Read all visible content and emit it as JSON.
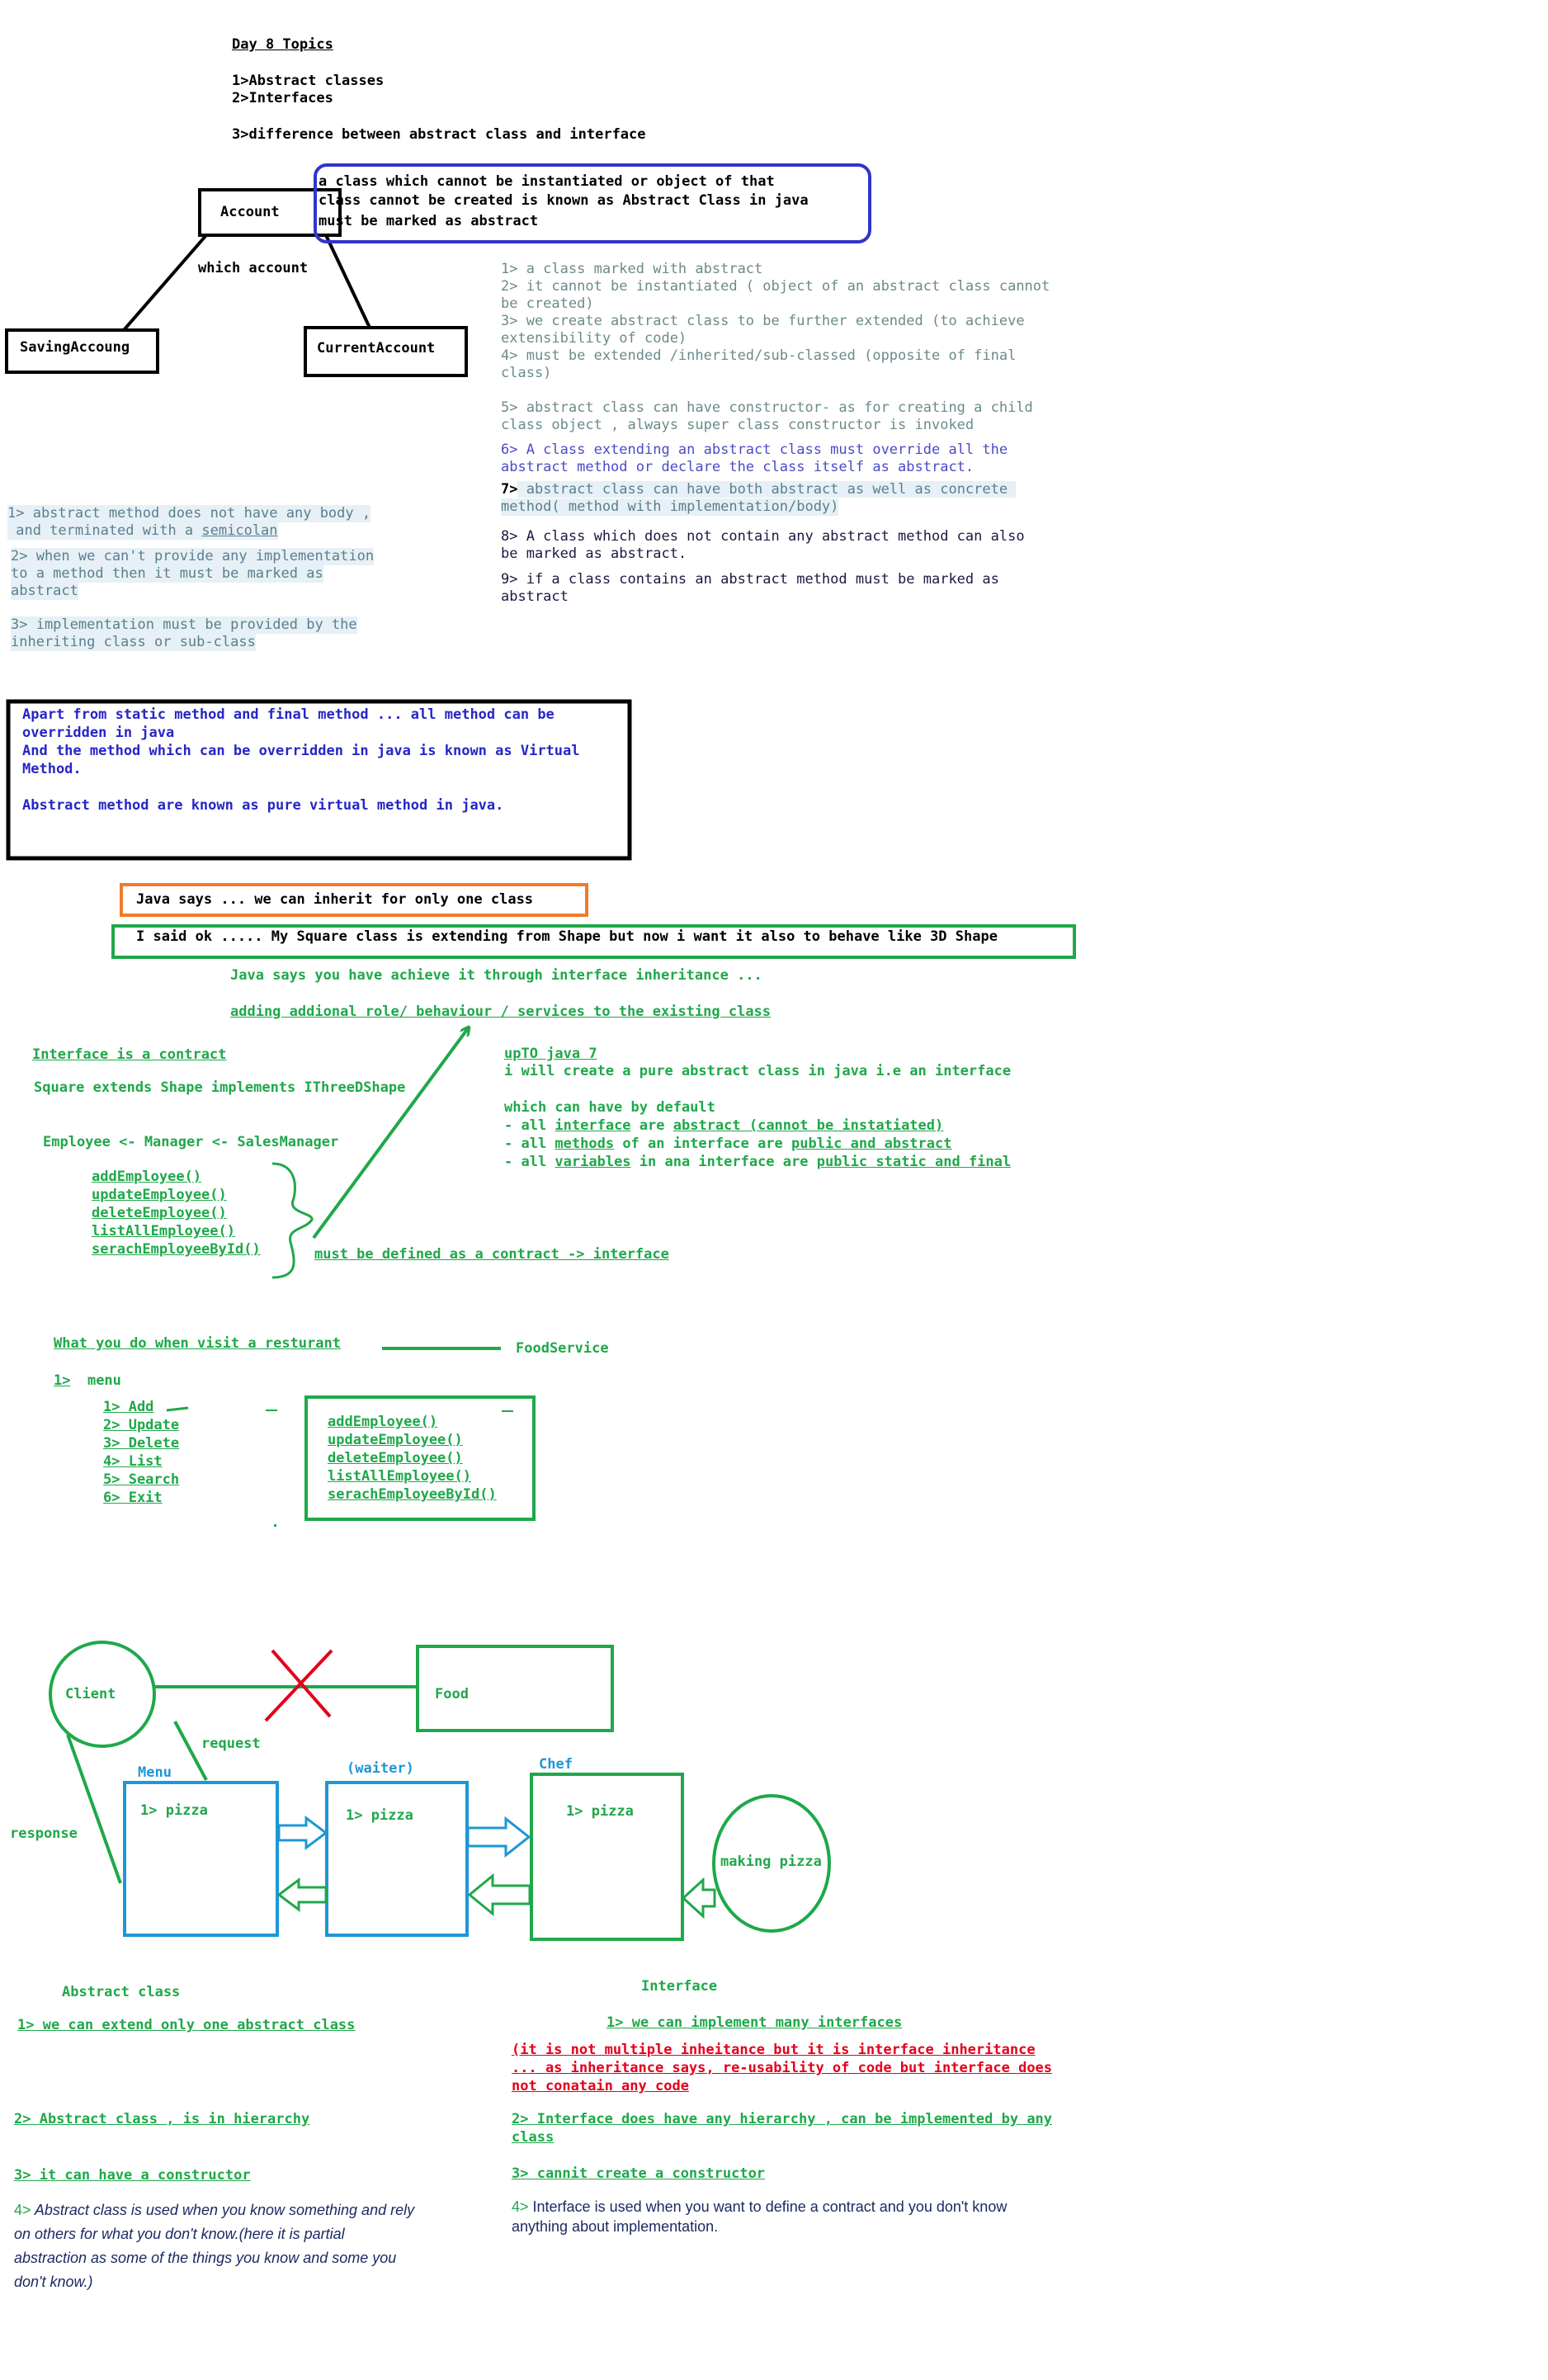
{
  "header": {
    "title": "Day 8 Topics",
    "topic_1": "1>Abstract classes",
    "topic_2": "2>Interfaces",
    "topic_3": "3>difference between abstract class and interface"
  },
  "account_diagram": {
    "account": "Account",
    "which_account": "which account",
    "saving": "SavingAccoung",
    "current": "CurrentAccount"
  },
  "definition_box": {
    "line_1": "a class which cannot be instantiated or object of that",
    "line_2": "class cannot be created is known as Abstract Class in java",
    "line_3": "must be marked as abstract"
  },
  "abstract_class_rules": [
    "1> a class marked with abstract",
    "2> it cannot be instantiated ( object of an abstract class cannot",
    "be created)",
    "3> we create abstract class to be further extended (to achieve",
    "extensibility of code)",
    "4> must be extended /inherited/sub-classed (opposite of final",
    "class)",
    "5> abstract class can have constructor- as for creating a child",
    "class object , always super class constructor is invoked",
    "6> A class extending an abstract class must override all the",
    "abstract method or declare the class itself as abstract.",
    "7>",
    " abstract class can have both abstract as well as concrete ",
    "method( method with implementation/body)",
    "8> A class which does not contain any abstract method can also",
    "be marked as abstract.",
    "9> if a class contains an abstract method must be marked as",
    "abstract"
  ],
  "abstract_method_rules": [
    "1> abstract method does not have any body ,",
    " and terminated with a ",
    "semicolan",
    "2> when we can't provide any implementation",
    "to a method then it must be marked as",
    "abstract",
    "3> implementation must be provided by the",
    "inheriting class or sub-class"
  ],
  "virtual_box": {
    "line_1": "Apart from static method and final method ... all method can be",
    "line_2": "overridden in java",
    "line_3": "And the method which can be overridden in java is known as Virtual",
    "line_4": "Method.",
    "line_5": "Abstract method are known as pure virtual method in java."
  },
  "inheritance": {
    "java_says": "Java says ... we can inherit for only one class",
    "i_said": "I said ok ..... My Square class is extending from Shape but now i want it also to behave like 3D Shape",
    "java_says_2": "Java says you have achieve it through interface inheritance ...",
    "adding_role": "adding addional role/ behaviour / services to the existing class",
    "contract": "Interface is a contract",
    "square": "Square extends Shape implements IThreeDShape",
    "employee": "Employee <- Manager <- SalesManager",
    "methods": [
      "addEmployee()",
      "updateEmployee()",
      "deleteEmployee()",
      "listAllEmployee()",
      "serachEmployeeById()"
    ],
    "must_be_defined": "must be defined as a contract -> interface"
  },
  "java7": {
    "title": "upTO java 7",
    "line_1": "i will create a pure abstract class in java i.e an interface",
    "line_2": "which can have by default",
    "l3_a": "- all ",
    "l3_b": "interface",
    "l3_c": " are ",
    "l3_d": "abstract (cannot be instatiated)",
    "l4_a": "- all ",
    "l4_b": "methods",
    "l4_c": " of an interface are ",
    "l4_d": "public and abstract",
    "l5_a": "- all ",
    "l5_b": "variables",
    "l5_c": " in ana interface are ",
    "l5_d": "public static and final"
  },
  "restaurant": {
    "question": "What you do when visit a resturant",
    "food_service": "FoodService",
    "menu_num": "1>",
    "menu_word": "  menu",
    "menu_items": [
      "1> Add",
      "2> Update",
      "3> Delete",
      "4> List",
      "5> Search",
      "6> Exit"
    ],
    "box_methods": [
      "addEmployee()",
      "updateEmployee()",
      "deleteEmployee()",
      "listAllEmployee()",
      "serachEmployeeById()"
    ]
  },
  "flow": {
    "client": "Client",
    "food": "Food",
    "request": "request",
    "response": "response",
    "menu_label": "Menu",
    "waiter_label": "(waiter)",
    "chef_label": "Chef",
    "menu_pizza": "1> pizza",
    "waiter_pizza": "1> pizza",
    "chef_pizza": "1> pizza",
    "making_pizza": "making pizza"
  },
  "comparison": {
    "abstract_heading": "Abstract class",
    "interface_heading": "Interface",
    "a1": "1> we can extend only one abstract class",
    "i1": "1> we can implement many interfaces",
    "i1_red_1": "(it is not multiple inheitance but it is interface inheritance",
    "i1_red_2": "... as inheritance says, re-usability of code but interface does",
    "i1_red_3": "not conatain any code",
    "a2": "2> Abstract class , is in hierarchy",
    "i2_1": "2> Interface does have any hierarchy , can be implemented by any",
    "i2_2": "class",
    "a3": "3> it can have a constructor",
    "i3": "3> cannit create a constructor",
    "a4_num": "4>",
    "a4_1": " Abstract class is used when you know something and rely",
    "a4_2": "on others for what you don't know.(here it is partial",
    "a4_3": "abstraction as some of the things you know and some you",
    "a4_4": "don't know.)",
    "i4_num": "4>",
    "i4_1": " Interface is used when you want to define a contract and you don't know",
    "i4_2": "anything about implementation."
  },
  "colors": {
    "green": "#1fa84a",
    "blue": "#1d97d6",
    "purple_box": "#3333cc",
    "orange": "#f07b2a",
    "red": "#e3001b",
    "text_blue": "#2626c6"
  }
}
